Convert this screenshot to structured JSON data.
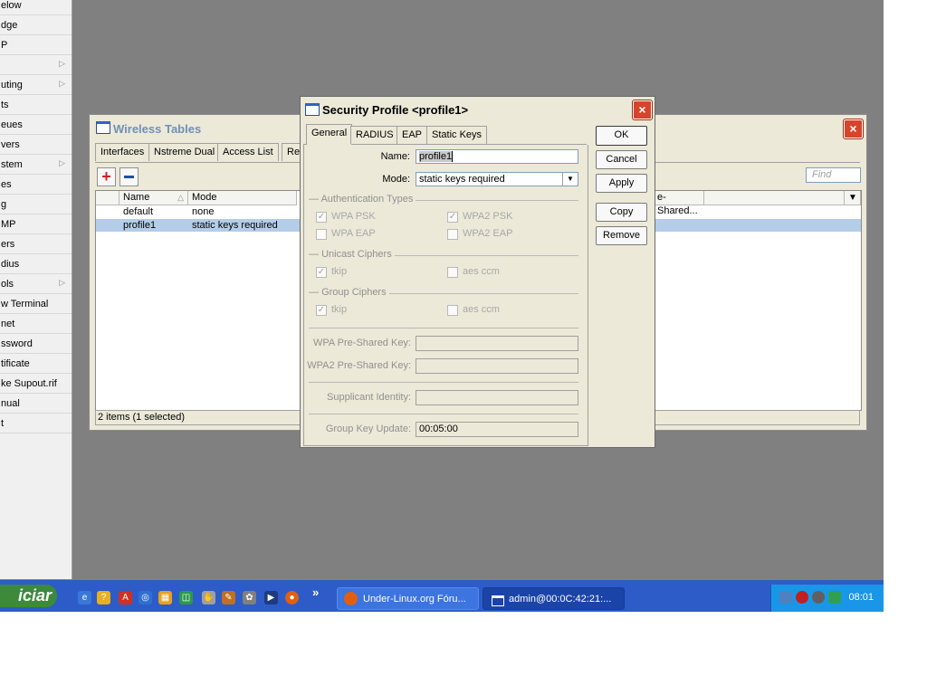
{
  "sidebar": {
    "items": [
      {
        "label": "elow",
        "arrow": false
      },
      {
        "label": "dge",
        "arrow": false
      },
      {
        "label": "P",
        "arrow": false
      },
      {
        "label": "",
        "arrow": true
      },
      {
        "label": "uting",
        "arrow": true
      },
      {
        "label": "ts",
        "arrow": false
      },
      {
        "label": "eues",
        "arrow": false
      },
      {
        "label": "vers",
        "arrow": false
      },
      {
        "label": "stem",
        "arrow": true
      },
      {
        "label": "es",
        "arrow": false
      },
      {
        "label": "g",
        "arrow": false
      },
      {
        "label": "MP",
        "arrow": false
      },
      {
        "label": "ers",
        "arrow": false
      },
      {
        "label": "dius",
        "arrow": false
      },
      {
        "label": "ols",
        "arrow": true
      },
      {
        "label": "w Terminal",
        "arrow": false
      },
      {
        "label": "net",
        "arrow": false
      },
      {
        "label": "ssword",
        "arrow": false
      },
      {
        "label": "tificate",
        "arrow": false
      },
      {
        "label": "ke Supout.rif",
        "arrow": false
      },
      {
        "label": "nual",
        "arrow": false
      },
      {
        "label": "t",
        "arrow": false
      }
    ]
  },
  "wireless_tables": {
    "title": "Wireless Tables",
    "tabs": [
      "Interfaces",
      "Nstreme Dual",
      "Access List",
      "Reg"
    ],
    "find_placeholder": "Find",
    "columns": {
      "name": "Name",
      "mode": "Mode",
      "wpa2_key": "e-Shared..."
    },
    "rows": [
      {
        "name": "default",
        "mode": "none",
        "selected": false
      },
      {
        "name": "profile1",
        "mode": "static keys required",
        "selected": true
      }
    ],
    "status": "2 items (1 selected)"
  },
  "security_profile": {
    "title": "Security Profile <profile1>",
    "tabs": [
      "General",
      "RADIUS",
      "EAP",
      "Static Keys"
    ],
    "buttons": {
      "ok": "OK",
      "cancel": "Cancel",
      "apply": "Apply",
      "copy": "Copy",
      "remove": "Remove"
    },
    "name_label": "Name:",
    "name_value": "profile1",
    "mode_label": "Mode:",
    "mode_value": "static keys required",
    "auth_group": "Authentication Types",
    "wpa_psk": "WPA PSK",
    "wpa2_psk": "WPA2 PSK",
    "wpa_eap": "WPA EAP",
    "wpa2_eap": "WPA2 EAP",
    "unicast_group": "Unicast Ciphers",
    "group_group": "Group Ciphers",
    "tkip": "tkip",
    "aes_ccm": "aes ccm",
    "wpa_key_label": "WPA Pre-Shared Key:",
    "wpa2_key_label": "WPA2 Pre-Shared Key:",
    "supplicant_label": "Supplicant Identity:",
    "group_key_label": "Group Key Update:",
    "group_key_value": "00:05:00"
  },
  "taskbar": {
    "start_label": "iciar",
    "windows": [
      {
        "label": "Under-Linux.org Fóru...",
        "active": false
      },
      {
        "label": "admin@00:0C:42:21:...",
        "active": true
      }
    ],
    "more": "»",
    "clock": "08:01"
  }
}
